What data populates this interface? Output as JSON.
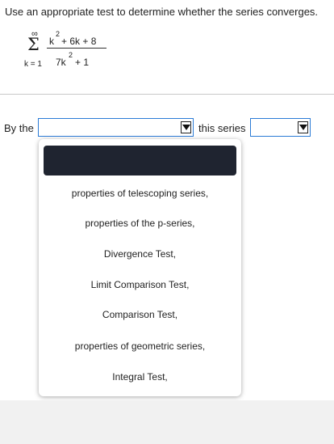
{
  "question": {
    "prompt": "Use an appropriate test to determine whether the series converges.",
    "sum_upper": "∞",
    "sigma": "Σ",
    "sum_lower": "k = 1",
    "numerator": "k",
    "numerator_exp": "2",
    "numerator_rest": "+ 6k + 8",
    "denominator": "7k",
    "denominator_exp": "2",
    "denominator_rest": "+ 1"
  },
  "answer": {
    "prefix": "By the",
    "test_select_value": "",
    "middle": "this series",
    "convergence_select_value": ""
  },
  "dropdown": {
    "selected_value": "",
    "options": [
      "properties of telescoping series,",
      "properties of the p-series,",
      "Divergence Test,",
      "Limit Comparison Test,",
      "Comparison Test,",
      "properties of geometric series,",
      "Integral Test,"
    ]
  },
  "colors": {
    "select_border": "#2b7bd6",
    "highlight": "#1f2430",
    "footer": "#f1f1f1"
  }
}
